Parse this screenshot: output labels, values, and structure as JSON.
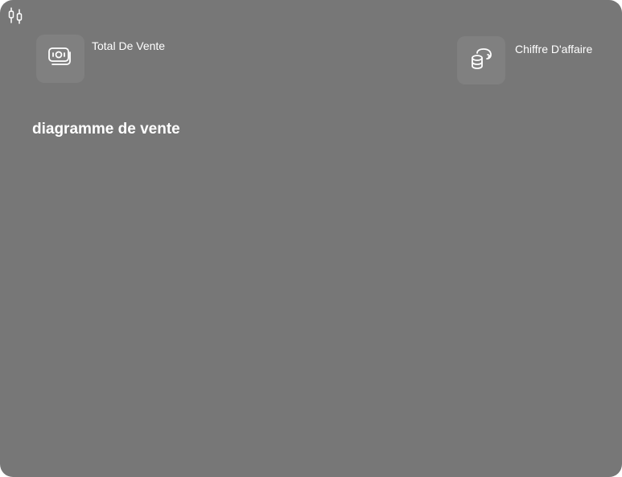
{
  "cards": {
    "total_sales": {
      "label": "Total De Vente",
      "icon": "cash-icon"
    },
    "revenue": {
      "label": "Chiffre D'affaire",
      "icon": "coins-icon"
    }
  },
  "chart": {
    "title": "diagramme de vente"
  },
  "colors": {
    "panel_bg": "#777777",
    "icon_box_bg": "#808080",
    "text": "#ffffff"
  }
}
